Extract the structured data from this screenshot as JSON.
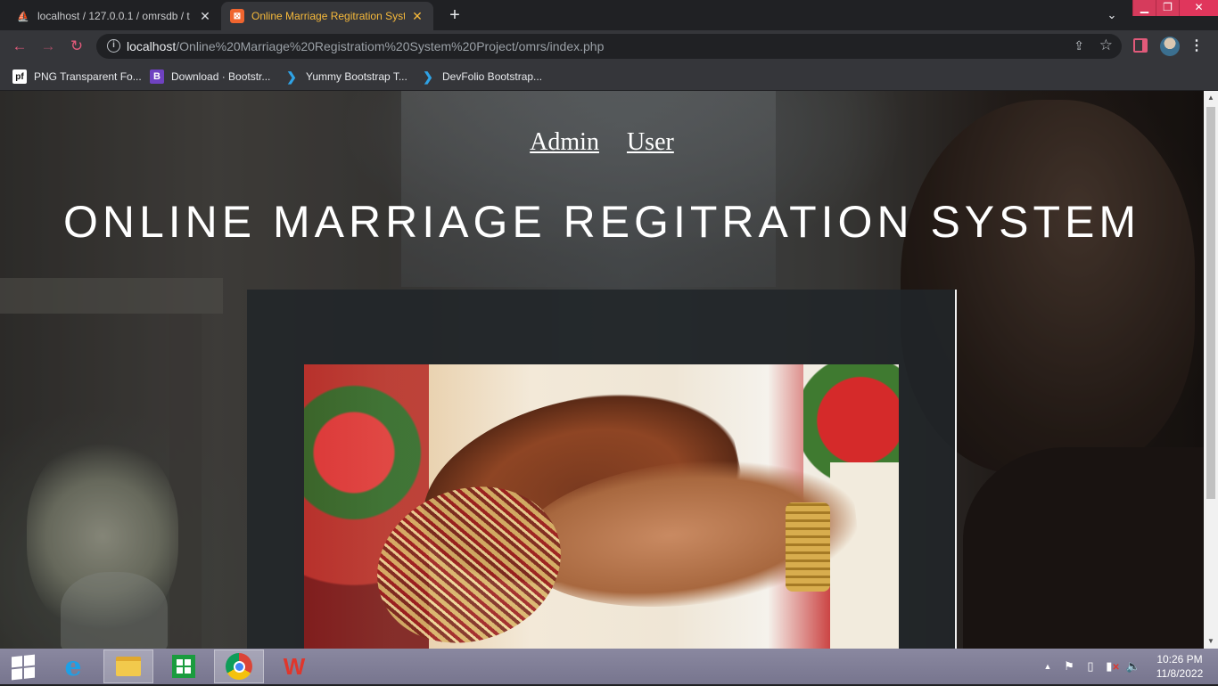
{
  "browser": {
    "tabs": [
      {
        "title": "localhost / 127.0.0.1 / omrsdb / t",
        "icon": "phpmyadmin-icon",
        "active": false
      },
      {
        "title": "Online Marriage Regitration Syste",
        "icon": "xampp-icon",
        "active": true
      }
    ],
    "new_tab": "+",
    "url": {
      "host": "localhost",
      "path": "/Online%20Marriage%20Registratiom%20System%20Project/omrs/index.php"
    },
    "bookmarks": [
      {
        "label": "PNG Transparent Fo...",
        "icon_text": "pf"
      },
      {
        "label": "Download · Bootstr...",
        "icon_text": "B"
      },
      {
        "label": "Yummy Bootstrap T...",
        "icon_text": "❯"
      },
      {
        "label": "DevFolio Bootstrap...",
        "icon_text": "❯"
      }
    ],
    "accent": "#e15a7a"
  },
  "page": {
    "nav": {
      "admin": "Admin",
      "user": "User"
    },
    "title": "ONLINE MARRIAGE REGITRATION SYSTEM"
  },
  "taskbar": {
    "apps": [
      "internet-explorer",
      "file-explorer",
      "store",
      "chrome",
      "wps-office"
    ],
    "clock": {
      "time": "10:26 PM",
      "date": "11/8/2022"
    }
  }
}
